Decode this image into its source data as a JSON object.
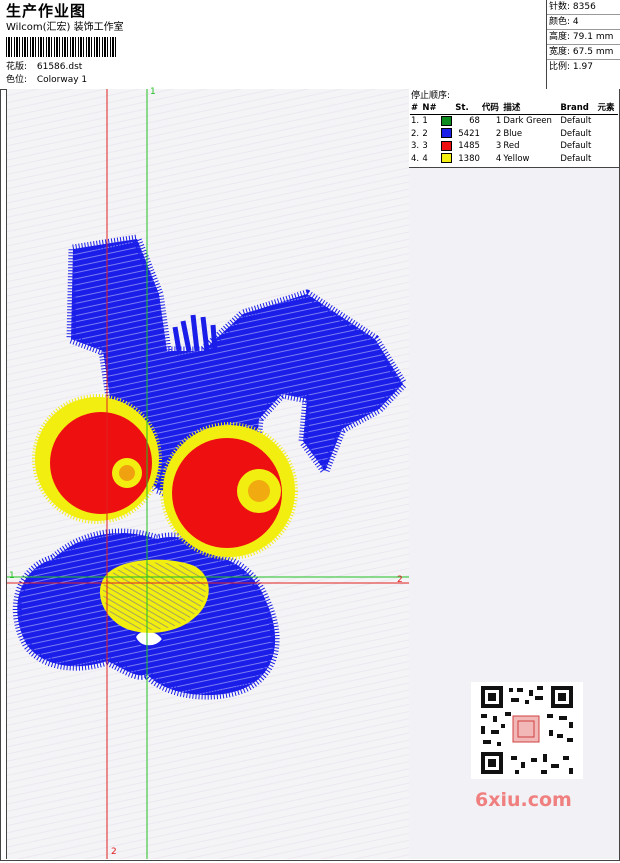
{
  "header": {
    "title": "生产作业图",
    "company": "Wilcom(汇宏) 装饰工作室",
    "pattern_label": "花版:",
    "pattern_value": "61586.dst",
    "color_label": "色位:",
    "color_value": "Colorway 1"
  },
  "stats": [
    {
      "label": "针数:",
      "value": "8356"
    },
    {
      "label": "颜色:",
      "value": "4"
    },
    {
      "label": "高度:",
      "value": "79.1 mm"
    },
    {
      "label": "宽度:",
      "value": "67.5 mm"
    },
    {
      "label": "比例:",
      "value": "1.97"
    }
  ],
  "stop_sequence": {
    "title": "停止顺序:",
    "columns": [
      "#",
      "N#",
      "St.",
      "代码",
      "描述",
      "Brand",
      "元素"
    ],
    "rows": [
      {
        "idx": "1.",
        "n": "1",
        "color": "#0c8a1e",
        "st": "68",
        "code": "1",
        "desc": "Dark Green",
        "brand": "Default"
      },
      {
        "idx": "2.",
        "n": "2",
        "color": "#1a1ee8",
        "st": "5421",
        "code": "2",
        "desc": "Blue",
        "brand": "Default"
      },
      {
        "idx": "3.",
        "n": "3",
        "color": "#ee1010",
        "st": "1485",
        "code": "3",
        "desc": "Red",
        "brand": "Default"
      },
      {
        "idx": "4.",
        "n": "4",
        "color": "#f2ee10",
        "st": "1380",
        "code": "4",
        "desc": "Yellow",
        "brand": "Default"
      }
    ]
  },
  "axes": {
    "v1_top": "1",
    "v1_bottom": "2",
    "h_left": "1",
    "h_right": "2",
    "v2_bottom": "2"
  },
  "watermark": "6xiu.com",
  "colors": {
    "blue": "#1a1ee8",
    "red": "#ee1010",
    "yellow": "#f2ee10",
    "green": "#0c8a1e",
    "axis_red": "#e02020",
    "axis_green": "#20c020"
  }
}
